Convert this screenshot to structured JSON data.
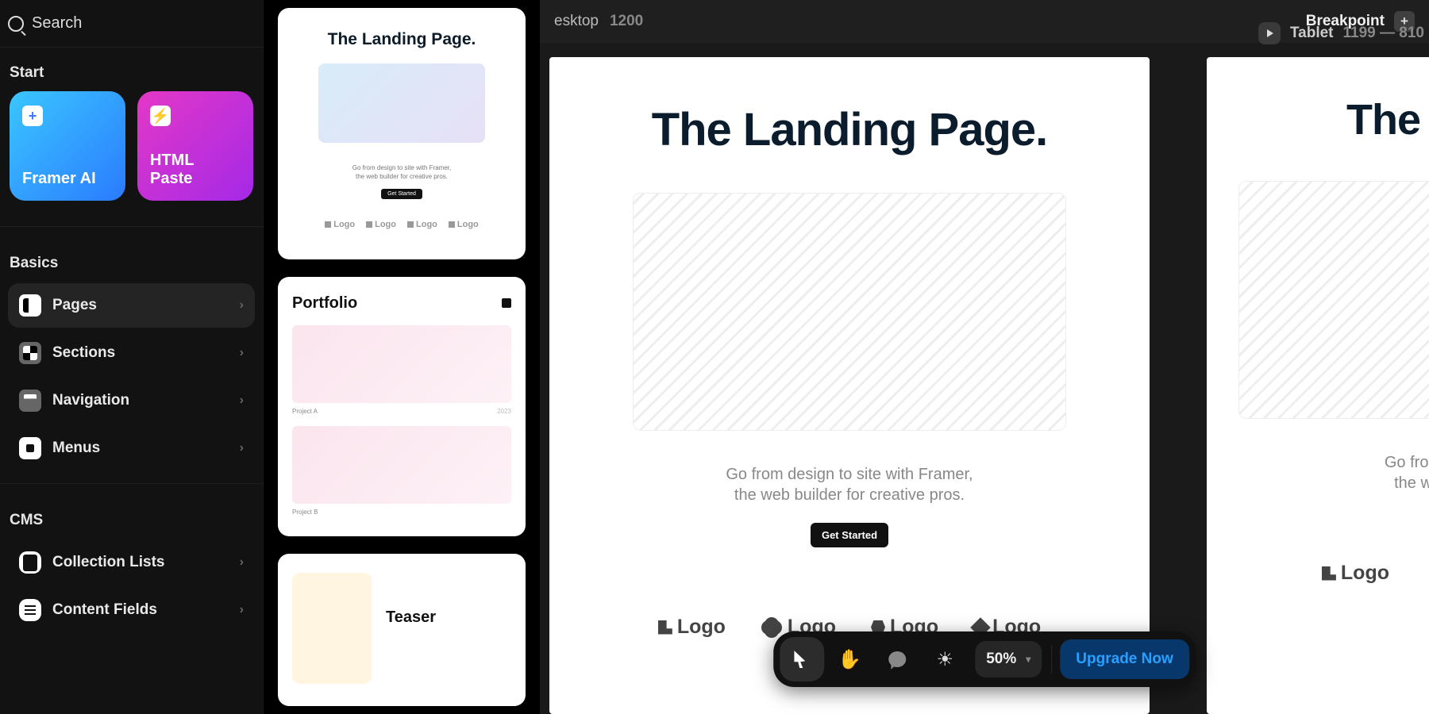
{
  "sidebar": {
    "search_placeholder": "Search",
    "sections": {
      "start": "Start",
      "basics": "Basics",
      "cms": "CMS"
    },
    "start_cards": {
      "ai": "Framer AI",
      "paste": "HTML Paste"
    },
    "basics_items": [
      {
        "label": "Pages",
        "active": true
      },
      {
        "label": "Sections",
        "active": false
      },
      {
        "label": "Navigation",
        "active": false
      },
      {
        "label": "Menus",
        "active": false
      }
    ],
    "cms_items": [
      {
        "label": "Collection Lists"
      },
      {
        "label": "Content Fields"
      }
    ]
  },
  "templates": {
    "card1": {
      "title": "The Landing Page.",
      "sub1": "Go from design to site with Framer,",
      "sub2": "the web builder for creative pros.",
      "cta": "Get Started",
      "logo": "Logo"
    },
    "card2": {
      "title": "Portfolio",
      "project_a": "Project A",
      "year_a": "2023",
      "project_b": "Project B"
    },
    "card3": {
      "title": "Teaser"
    }
  },
  "topbar": {
    "left_label": "esktop",
    "left_size": "1200",
    "breakpoint_label": "Breakpoint"
  },
  "canvas": {
    "desktop": {
      "title": "The Landing Page.",
      "sub1": "Go from design to site with Framer,",
      "sub2": "the web builder for creative pros.",
      "cta": "Get Started",
      "logo_text": "Logo"
    },
    "tablet_header": {
      "name": "Tablet",
      "range": "1199 — 810"
    },
    "tablet": {
      "title": "The La",
      "sub1": "Go from",
      "sub2": "the w",
      "logo_text": "Logo"
    }
  },
  "toolbar": {
    "zoom": "50%",
    "upgrade": "Upgrade Now"
  }
}
